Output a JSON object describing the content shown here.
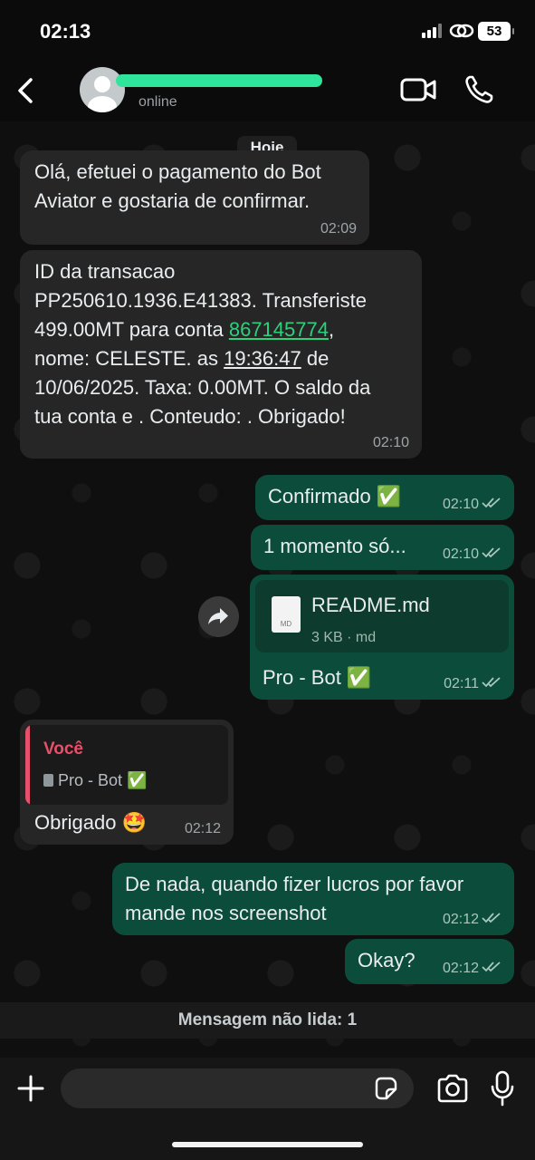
{
  "status_bar": {
    "time": "02:13",
    "battery": "53"
  },
  "header": {
    "contact_status": "online"
  },
  "chat": {
    "date_label": "Hoje",
    "messages": [
      {
        "direction": "in",
        "lines": [
          "Olá, efetuei o pagamento do Bot",
          "Aviator e gostaria de confirmar."
        ],
        "time": "02:09"
      },
      {
        "direction": "in",
        "line1": "ID da transacao",
        "line2": "PP250610.1936.E41383. Transferiste",
        "line3_prefix": "499.00MT para conta ",
        "line3_link": "867145774",
        "line3_suffix": ",",
        "line4_prefix": "nome: CELESTE. as ",
        "line4_time": "19:36:47",
        "line4_suffix": " de",
        "line5": "10/06/2025. Taxa: 0.00MT. O saldo da",
        "line6": "tua conta e . Conteudo: . Obrigado!",
        "time": "02:10"
      },
      {
        "direction": "out",
        "text": "Confirmado ✅",
        "time": "02:10"
      },
      {
        "direction": "out",
        "text": "1 momento só...",
        "time": "02:10"
      },
      {
        "direction": "out",
        "file_name": "README.md",
        "file_info": "3 KB · md",
        "file_icon_label": "MD",
        "caption": "Pro - Bot ✅",
        "time": "02:11"
      },
      {
        "direction": "in",
        "quote_author": "Você",
        "quote_text": "Pro - Bot ✅",
        "text": "Obrigado 🤩",
        "time": "02:12"
      },
      {
        "direction": "out",
        "lines": [
          "De nada, quando fizer lucros por favor",
          "mande nos screenshot"
        ],
        "time": "02:12"
      },
      {
        "direction": "out",
        "text": "Okay?",
        "time": "02:12"
      }
    ],
    "unread_label": "Mensagem não lida: 1"
  },
  "composer": {
    "value": ""
  },
  "icons": [
    "back-icon",
    "avatar-icon",
    "video-call-icon",
    "phone-icon",
    "forward-icon",
    "document-icon",
    "plus-icon",
    "sticker-icon",
    "camera-icon",
    "microphone-icon",
    "double-check-icon"
  ],
  "colors": {
    "incoming": "#262626",
    "outgoing": "#0b4d3a",
    "link": "#2dd17b",
    "quote_accent": "#e6506b"
  }
}
